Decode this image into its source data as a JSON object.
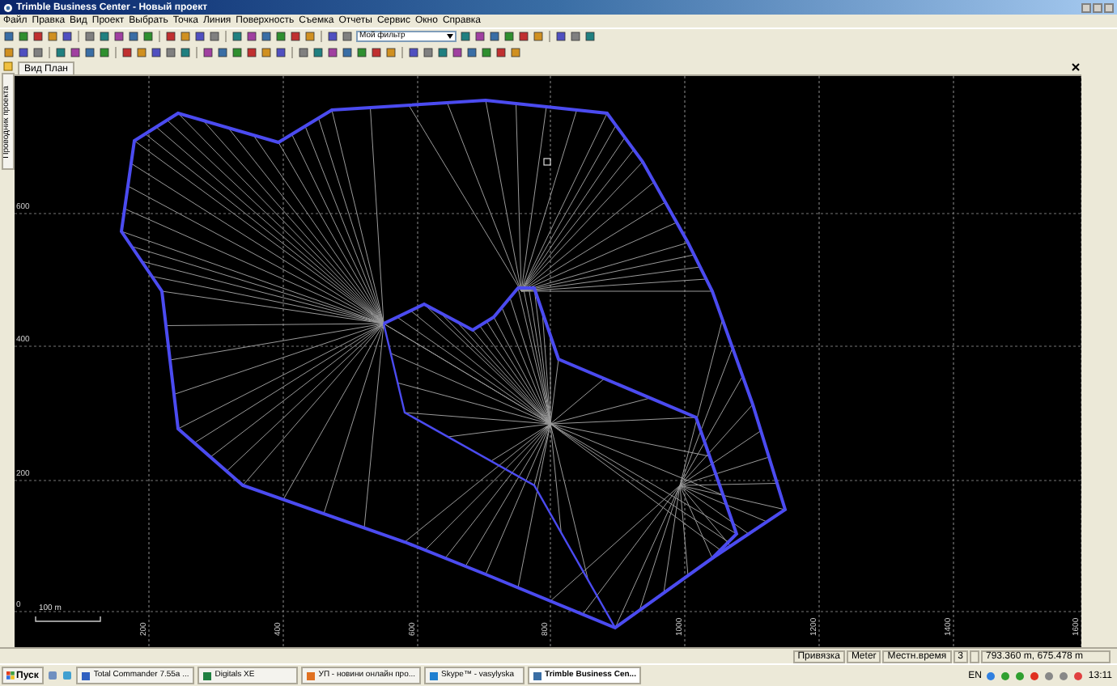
{
  "window": {
    "title": "Trimble Business Center - Новый проект"
  },
  "menu": [
    "Файл",
    "Правка",
    "Вид",
    "Проект",
    "Выбрать",
    "Точка",
    "Линия",
    "Поверхность",
    "Съемка",
    "Отчеты",
    "Сервис",
    "Окно",
    "Справка"
  ],
  "toolbar": {
    "filter": "Мой фильтр"
  },
  "side_tab": "Проводник проекта",
  "tabs": [
    {
      "label": "Вид План",
      "selected": true
    }
  ],
  "plan_view": {
    "y_labels": [
      "600",
      "400",
      "200",
      "0"
    ],
    "x_labels": [
      "200",
      "400",
      "600",
      "800",
      "1000",
      "1200",
      "1400",
      "1600"
    ],
    "scale": "100 m"
  },
  "status_bar": [
    "Привязка",
    "Meter",
    "Местн.время",
    "3",
    "793.360 m, 675.478 m"
  ],
  "taskbar": {
    "start": "Пуск",
    "tasks": [
      {
        "label": "Total Commander 7.55a ...",
        "selected": false
      },
      {
        "label": "Digitals XE",
        "selected": false
      },
      {
        "label": "УП - новини онлайн про...",
        "selected": false
      },
      {
        "label": "Skype™ - vasylyska",
        "selected": false
      },
      {
        "label": "Trimble Business Cen...",
        "selected": true
      }
    ],
    "language": "EN",
    "time": "13:11"
  }
}
